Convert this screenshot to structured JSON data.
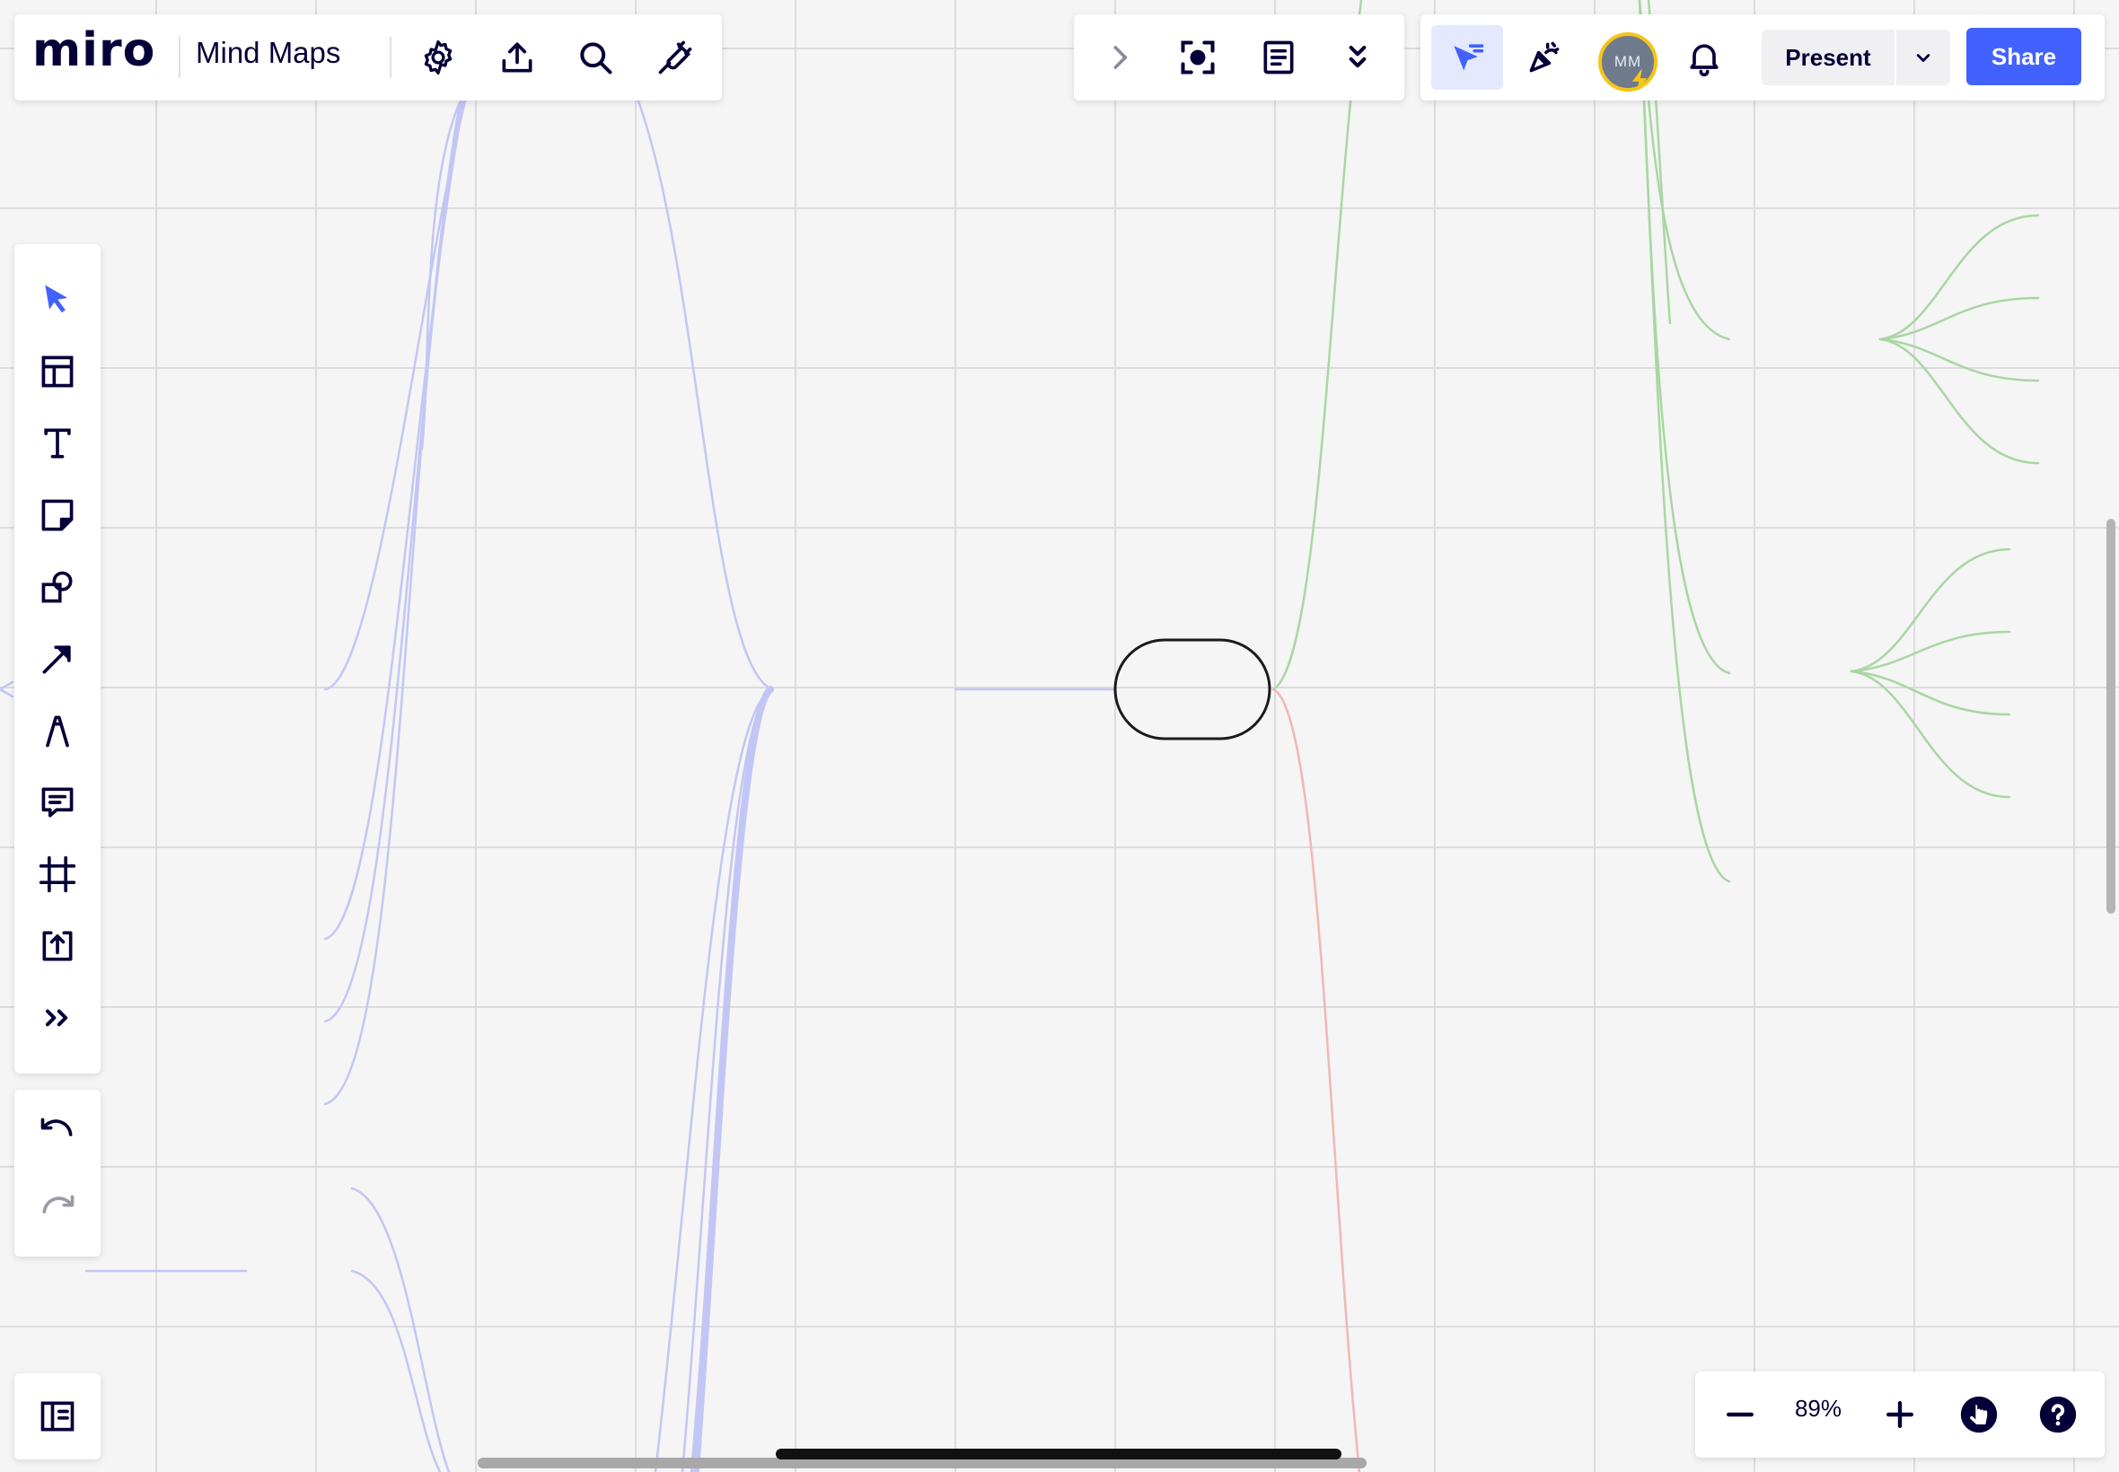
{
  "app": {
    "logo": "miro",
    "board_title": "Mind Maps"
  },
  "header_left": {
    "icons": [
      "settings-icon",
      "export-icon",
      "search-icon",
      "plugin-icon"
    ]
  },
  "header_mid": {
    "icons": [
      "chevron-right-icon",
      "focus-frame-icon",
      "notes-icon",
      "double-chevron-down-icon"
    ]
  },
  "header_right": {
    "avatar_initials": "MM",
    "present_label": "Present",
    "share_label": "Share"
  },
  "toolbar": {
    "tools": [
      "select",
      "templates",
      "text",
      "sticky-note",
      "shapes",
      "connection-line",
      "pen",
      "comment",
      "frame",
      "upload",
      "more"
    ],
    "undo": "undo",
    "redo": "redo"
  },
  "zoom": {
    "level_label": "89%"
  },
  "colors": {
    "accent": "#4262ff",
    "canvas": "#f5f5f5",
    "grid": "#dcdcdc",
    "branch_blue": "#c3c6f5",
    "branch_green": "#a9d6a3",
    "branch_red": "#f4b6b6"
  }
}
